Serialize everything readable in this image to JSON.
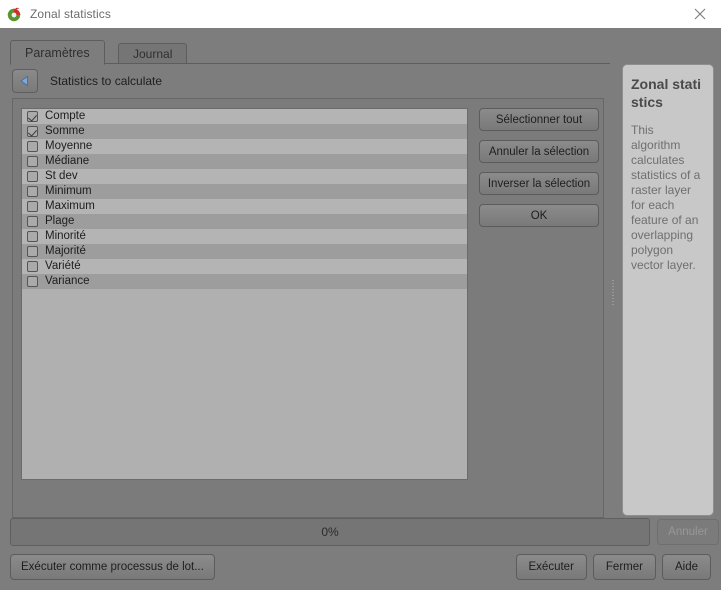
{
  "window": {
    "title": "Zonal statistics",
    "icon": "qgis-logo-icon",
    "close_label": "×"
  },
  "tabs": [
    {
      "label": "Paramètres",
      "active": true
    },
    {
      "label": "Journal",
      "active": false
    }
  ],
  "group": {
    "back_icon": "left-arrow-icon",
    "label": "Statistics to calculate"
  },
  "statistics": [
    {
      "label": "Compte",
      "checked": true
    },
    {
      "label": "Somme",
      "checked": true
    },
    {
      "label": "Moyenne",
      "checked": false
    },
    {
      "label": "Médiane",
      "checked": false
    },
    {
      "label": "St dev",
      "checked": false
    },
    {
      "label": "Minimum",
      "checked": false
    },
    {
      "label": "Maximum",
      "checked": false
    },
    {
      "label": "Plage",
      "checked": false
    },
    {
      "label": "Minorité",
      "checked": false
    },
    {
      "label": "Majorité",
      "checked": false
    },
    {
      "label": "Variété",
      "checked": false
    },
    {
      "label": "Variance",
      "checked": false
    }
  ],
  "list_buttons": [
    {
      "label": "Sélectionner tout"
    },
    {
      "label": "Annuler la sélection"
    },
    {
      "label": "Inverser la sélection"
    },
    {
      "label": "OK"
    }
  ],
  "help": {
    "title": "Zonal statistics",
    "body": "This algorithm calculates statistics of a raster layer for each feature of an overlapping polygon vector layer."
  },
  "progress": {
    "text": "0%",
    "value": 0,
    "cancel_label": "Annuler",
    "cancel_disabled": true
  },
  "footer": {
    "batch_label": "Exécuter comme processus de lot...",
    "run_label": "Exécuter",
    "close_label": "Fermer",
    "help_label": "Aide"
  },
  "colors": {
    "dialog_bg": "#7d7d7d",
    "titlebar_bg": "#ffffff",
    "list_row_odd": "#b4b4b4",
    "list_row_even": "#9d9d9d",
    "help_bg": "#c8c8c8",
    "arrow_blue": "#7fa8d8"
  }
}
